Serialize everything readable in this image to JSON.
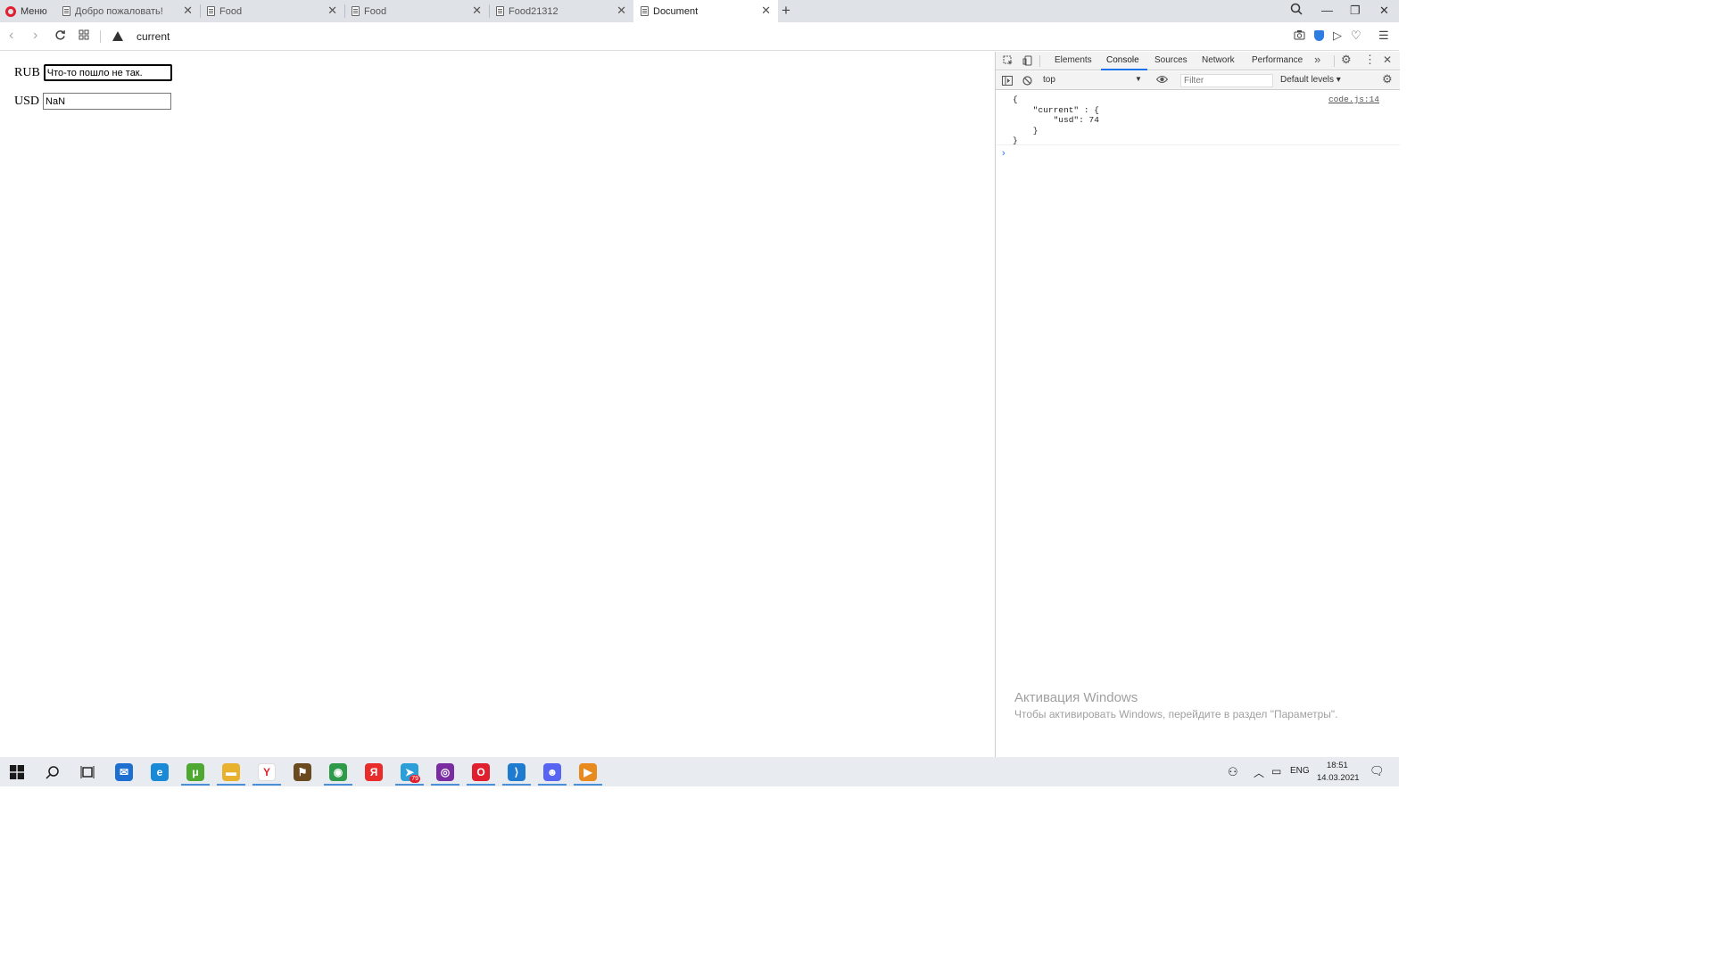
{
  "browser": {
    "menu_label": "Меню",
    "tabs": [
      {
        "title": "Добро пожаловать!",
        "active": false
      },
      {
        "title": "Food",
        "active": false
      },
      {
        "title": "Food",
        "active": false
      },
      {
        "title": "Food21312",
        "active": false
      },
      {
        "title": "Document",
        "active": true
      }
    ],
    "address": "current",
    "accent_color": "#e0202e"
  },
  "page": {
    "rub_label": "RUB",
    "rub_value": "Что-то пошло не так.",
    "usd_label": "USD",
    "usd_value": "NaN"
  },
  "devtools": {
    "tabs": [
      "Elements",
      "Console",
      "Sources",
      "Network",
      "Performance"
    ],
    "active_tab": "Console",
    "context": "top",
    "filter_placeholder": "Filter",
    "levels": "Default levels",
    "log_source": "code.js:14",
    "log_text": "{\n    \"current\" : {\n        \"usd\": 74\n    }\n}",
    "prompt": "›",
    "accent_color": "#1a73e8"
  },
  "watermark": {
    "title": "Активация Windows",
    "subtitle": "Чтобы активировать Windows, перейдите в раздел \"Параметры\"."
  },
  "taskbar": {
    "apps": [
      {
        "icon": "mail-icon",
        "color": "#1e6fd0",
        "running": false
      },
      {
        "icon": "edge-icon",
        "color": "#1b8ad6",
        "running": false
      },
      {
        "icon": "utorrent-icon",
        "color": "#4ea832",
        "running": true
      },
      {
        "icon": "folder-icon",
        "color": "#e8b12e",
        "running": true
      },
      {
        "icon": "yandex-browser-icon",
        "color": "#ffffff",
        "running": true
      },
      {
        "icon": "game-icon",
        "color": "#6a4a1e",
        "running": false
      },
      {
        "icon": "chrome-icon",
        "color": "#2f9a4a",
        "running": true
      },
      {
        "icon": "yandex-icon",
        "color": "#e82c2c",
        "running": false
      },
      {
        "icon": "telegram-icon",
        "color": "#2a9fd8",
        "running": true,
        "badge": "79"
      },
      {
        "icon": "tor-icon",
        "color": "#7a2da0",
        "running": true
      },
      {
        "icon": "opera-icon",
        "color": "#e0202e",
        "running": true
      },
      {
        "icon": "vscode-icon",
        "color": "#1f7bd0",
        "running": true
      },
      {
        "icon": "discord-icon",
        "color": "#5865f2",
        "running": true
      },
      {
        "icon": "media-player-icon",
        "color": "#e88a1e",
        "running": true
      }
    ],
    "language": "ENG",
    "time": "18:51",
    "date": "14.03.2021"
  }
}
